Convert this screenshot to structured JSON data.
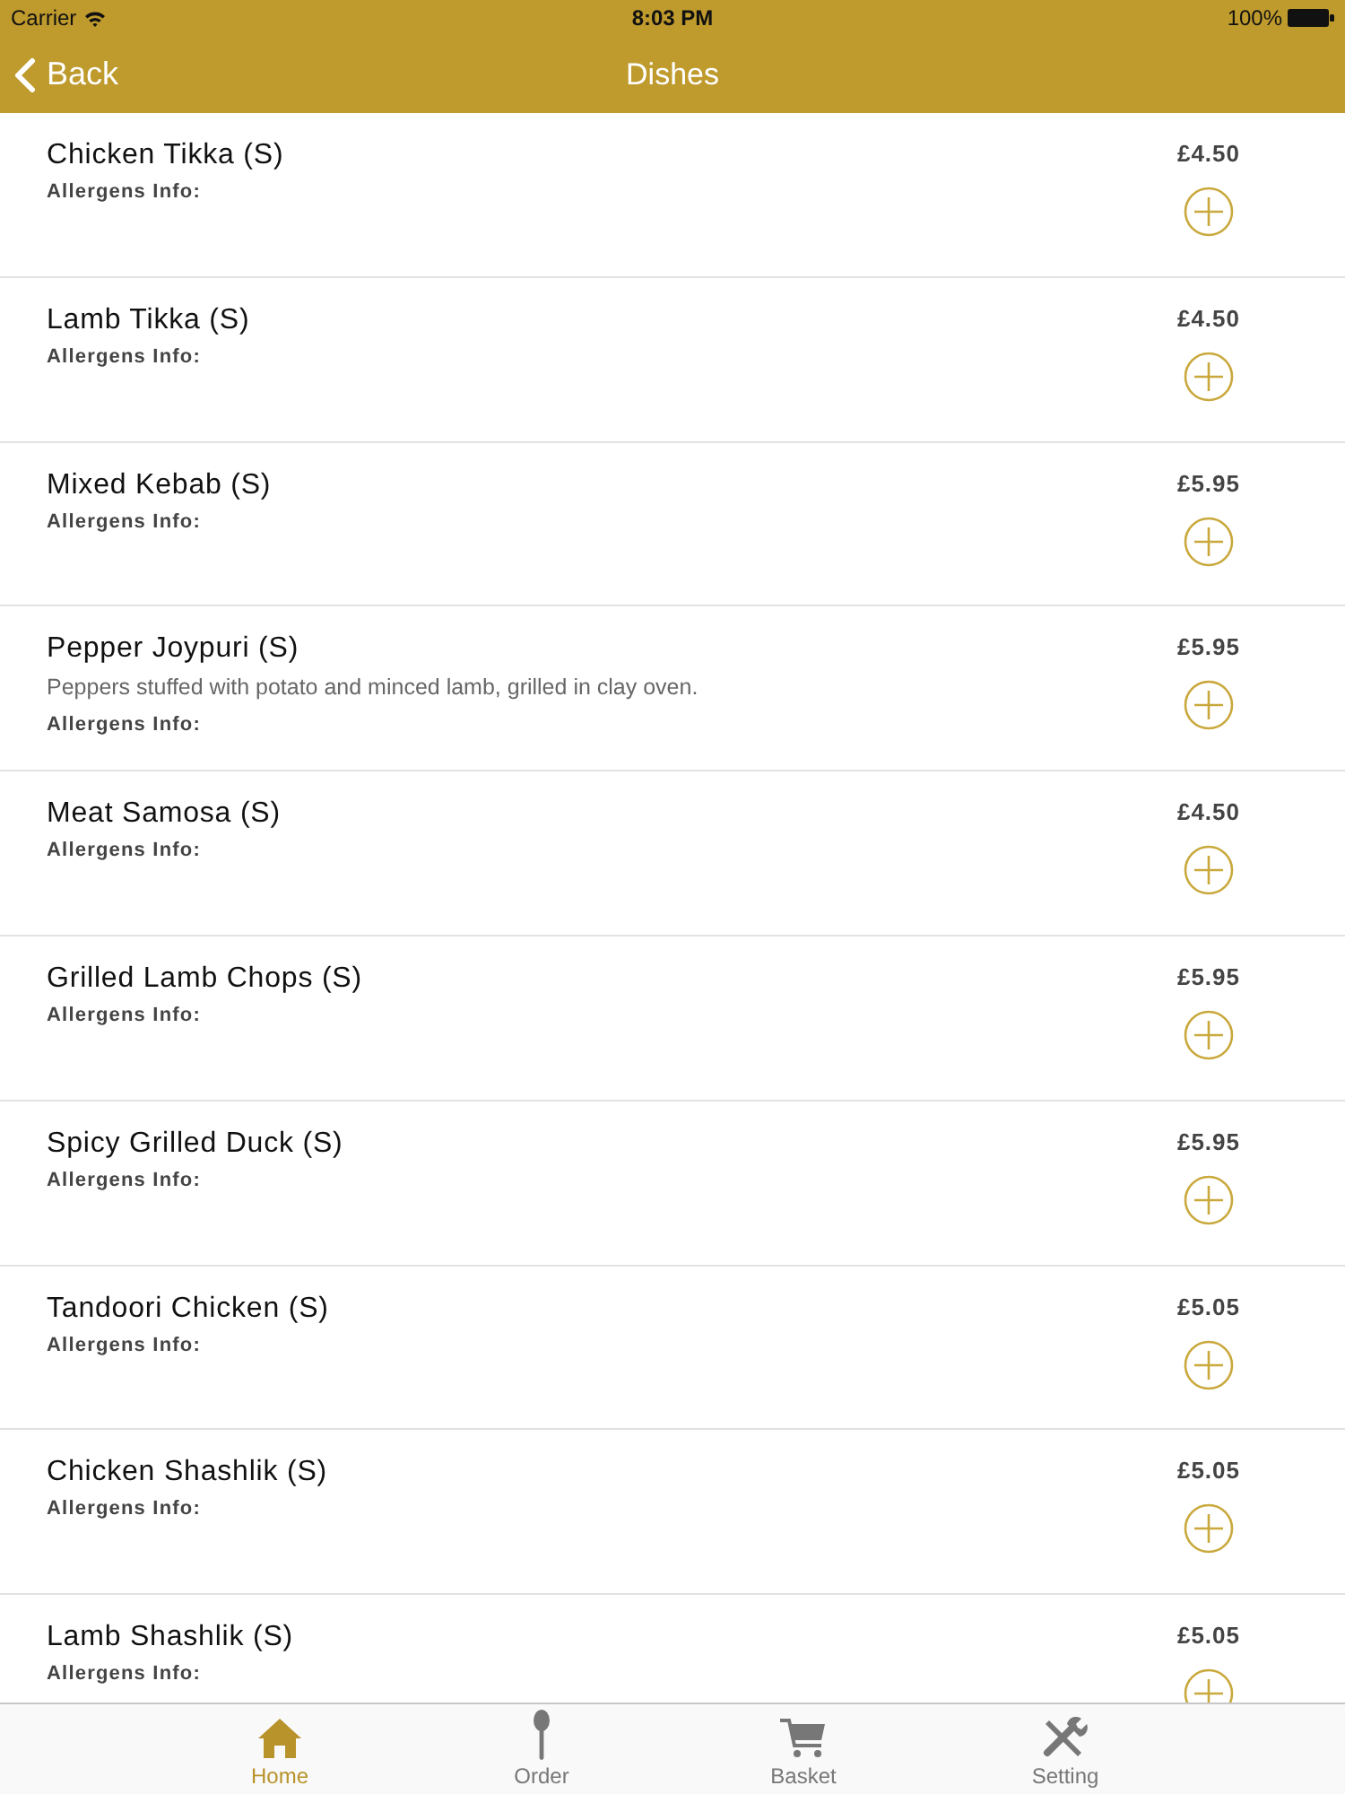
{
  "status_bar": {
    "carrier": "Carrier",
    "time": "8:03 PM",
    "battery": "100%"
  },
  "nav_bar": {
    "back": "Back",
    "title": "Dishes"
  },
  "dishes": [
    {
      "name": "Chicken Tikka (S)",
      "allergens": "Allergens Info:",
      "price": "£4.50"
    },
    {
      "name": "Lamb Tikka (S)",
      "allergens": "Allergens Info:",
      "price": "£4.50"
    },
    {
      "name": "Mixed Kebab (S)",
      "allergens": "Allergens Info:",
      "price": "£5.95"
    },
    {
      "name": "Pepper Joypuri (S)",
      "description": "Peppers stuffed with potato and minced lamb, grilled in clay oven.",
      "allergens": "Allergens Info:",
      "price": "£5.95"
    },
    {
      "name": "Meat Samosa (S)",
      "allergens": "Allergens Info:",
      "price": "£4.50"
    },
    {
      "name": "Grilled Lamb Chops (S)",
      "allergens": "Allergens Info:",
      "price": "£5.95"
    },
    {
      "name": "Spicy Grilled Duck (S)",
      "allergens": "Allergens Info:",
      "price": "£5.95"
    },
    {
      "name": "Tandoori Chicken (S)",
      "allergens": "Allergens Info:",
      "price": "£5.05"
    },
    {
      "name": "Chicken Shashlik (S)",
      "allergens": "Allergens Info:",
      "price": "£5.05"
    },
    {
      "name": "Lamb Shashlik (S)",
      "allergens": "Allergens Info:",
      "price": "£5.05"
    }
  ],
  "tab_bar": [
    {
      "kind": "home",
      "label": "Home",
      "selected": true
    },
    {
      "kind": "order",
      "label": "Order",
      "selected": false
    },
    {
      "kind": "basket",
      "label": "Basket",
      "selected": false
    },
    {
      "kind": "setting",
      "label": "Setting",
      "selected": false
    }
  ]
}
